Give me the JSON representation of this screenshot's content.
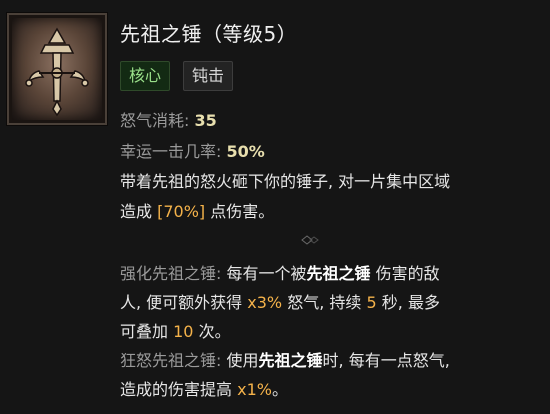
{
  "skill": {
    "title": "先祖之锤（等级5）",
    "tags": [
      "核心",
      "钝击"
    ],
    "stats": [
      {
        "label": "怒气消耗:",
        "value": "35"
      },
      {
        "label": "幸运一击几率:",
        "value": "50%"
      }
    ],
    "description": {
      "line1": "带着先祖的怒火砸下你的锤子, 对一片集中区域",
      "line2_a": "造成",
      "line2_value": "[70%]",
      "line2_b": "点伤害。"
    },
    "enhanced": {
      "label": "强化先祖之锤:",
      "l1_a": "每有一个被",
      "l1_name": "先祖之锤",
      "l1_b": "伤害的敌",
      "l2_a": "人, 便可额外获得",
      "l2_value": "x3%",
      "l2_b": "怒气, 持续",
      "l2_value2": "5",
      "l2_c": "秒, 最多",
      "l3_a": "可叠加",
      "l3_value": "10",
      "l3_b": "次。"
    },
    "furious": {
      "label": "狂怒先祖之锤:",
      "l1_a": "使用",
      "l1_name": "先祖之锤",
      "l1_b": "时, 每有一点怒气,",
      "l2_a": "造成的伤害提高",
      "l2_value": "x1%",
      "l2_b": "。"
    }
  },
  "icon": "ancestral-hammer-icon",
  "colors": {
    "background": "#151515",
    "core_tag_bg": "#132a13",
    "core_tag_text": "#9ae08a",
    "value_yellow": "#e8dfae",
    "value_orange": "#f4b24a",
    "label_gray": "#9a9a9a"
  }
}
